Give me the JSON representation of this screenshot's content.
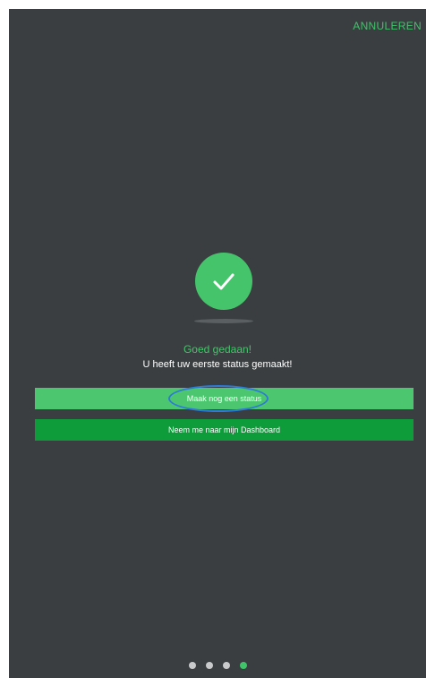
{
  "header": {
    "cancel_label": "ANNULEREN"
  },
  "success": {
    "title": "Goed gedaan!",
    "subtitle": "U heeft uw eerste status gemaakt!"
  },
  "buttons": {
    "primary_label": "Maak nog een status",
    "secondary_label": "Neem me naar mijn Dashboard"
  },
  "pager": {
    "total": 4,
    "active_index": 3
  },
  "colors": {
    "background": "#3a3e40",
    "accent": "#46c46c",
    "button_primary": "#4cc66f",
    "button_secondary": "#0e9b3a",
    "annotation": "#2e7bd6"
  },
  "icons": {
    "success": "checkmark-icon"
  }
}
